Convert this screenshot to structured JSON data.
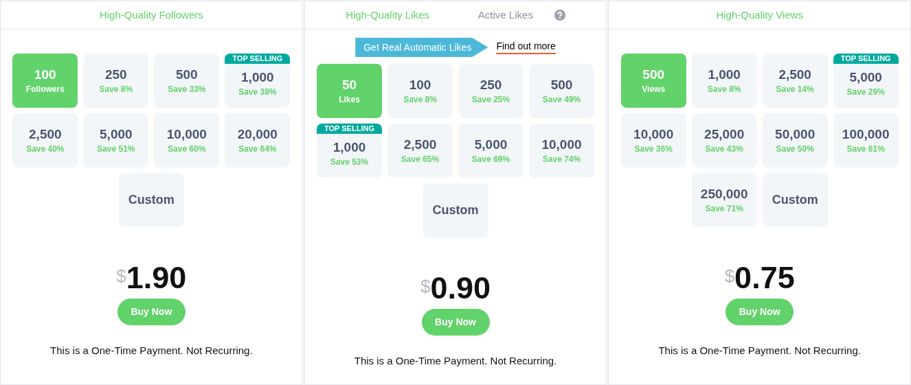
{
  "panels": [
    {
      "tabs": [
        {
          "label": "High-Quality Followers",
          "selected": true
        }
      ],
      "help": false,
      "options": [
        {
          "kind": "option",
          "amount": "100",
          "note": "Followers",
          "selected": true
        },
        {
          "kind": "option",
          "amount": "250",
          "note": "Save 8%",
          "selected": false
        },
        {
          "kind": "option",
          "amount": "500",
          "note": "Save 33%",
          "selected": false
        },
        {
          "kind": "option",
          "amount": "1,000",
          "note": "Save 38%",
          "selected": false,
          "badge": "TOP SELLING"
        },
        {
          "kind": "option",
          "amount": "2,500",
          "note": "Save 40%",
          "selected": false
        },
        {
          "kind": "option",
          "amount": "5,000",
          "note": "Save 51%",
          "selected": false
        },
        {
          "kind": "option",
          "amount": "10,000",
          "note": "Save 60%",
          "selected": false
        },
        {
          "kind": "option",
          "amount": "20,000",
          "note": "Save 64%",
          "selected": false
        },
        {
          "kind": "custom",
          "label": "Custom",
          "selected": false
        }
      ],
      "currency": "$",
      "price": "1.90",
      "button": "Buy Now",
      "note": "This is a One-Time Payment. Not Recurring."
    },
    {
      "tabs": [
        {
          "label": "High-Quality Likes",
          "selected": true
        },
        {
          "label": "Active Likes",
          "selected": false
        }
      ],
      "help": true,
      "promo": {
        "label": "Get Real Automatic Likes",
        "link": "Find out more"
      },
      "options": [
        {
          "kind": "option",
          "amount": "50",
          "note": "Likes",
          "selected": true
        },
        {
          "kind": "option",
          "amount": "100",
          "note": "Save 8%",
          "selected": false
        },
        {
          "kind": "option",
          "amount": "250",
          "note": "Save 25%",
          "selected": false
        },
        {
          "kind": "option",
          "amount": "500",
          "note": "Save 49%",
          "selected": false
        },
        {
          "kind": "option",
          "amount": "1,000",
          "note": "Save 53%",
          "selected": false,
          "badge": "TOP SELLING"
        },
        {
          "kind": "option",
          "amount": "2,500",
          "note": "Save 65%",
          "selected": false
        },
        {
          "kind": "option",
          "amount": "5,000",
          "note": "Save 69%",
          "selected": false
        },
        {
          "kind": "option",
          "amount": "10,000",
          "note": "Save 74%",
          "selected": false
        },
        {
          "kind": "custom",
          "label": "Custom",
          "selected": false
        }
      ],
      "currency": "$",
      "price": "0.90",
      "button": "Buy Now",
      "note": "This is a One-Time Payment. Not Recurring."
    },
    {
      "tabs": [
        {
          "label": "High-Quality Views",
          "selected": true
        }
      ],
      "help": false,
      "options": [
        {
          "kind": "option",
          "amount": "500",
          "note": "Views",
          "selected": true
        },
        {
          "kind": "option",
          "amount": "1,000",
          "note": "Save 8%",
          "selected": false
        },
        {
          "kind": "option",
          "amount": "2,500",
          "note": "Save 14%",
          "selected": false
        },
        {
          "kind": "option",
          "amount": "5,000",
          "note": "Save 29%",
          "selected": false,
          "badge": "TOP SELLING"
        },
        {
          "kind": "option",
          "amount": "10,000",
          "note": "Save 36%",
          "selected": false
        },
        {
          "kind": "option",
          "amount": "25,000",
          "note": "Save 43%",
          "selected": false
        },
        {
          "kind": "option",
          "amount": "50,000",
          "note": "Save 50%",
          "selected": false
        },
        {
          "kind": "option",
          "amount": "100,000",
          "note": "Save 61%",
          "selected": false
        },
        {
          "kind": "option",
          "amount": "250,000",
          "note": "Save 71%",
          "selected": false
        },
        {
          "kind": "custom",
          "label": "Custom",
          "selected": false
        }
      ],
      "currency": "$",
      "price": "0.75",
      "button": "Buy Now",
      "note": "This is a One-Time Payment. Not Recurring."
    }
  ]
}
